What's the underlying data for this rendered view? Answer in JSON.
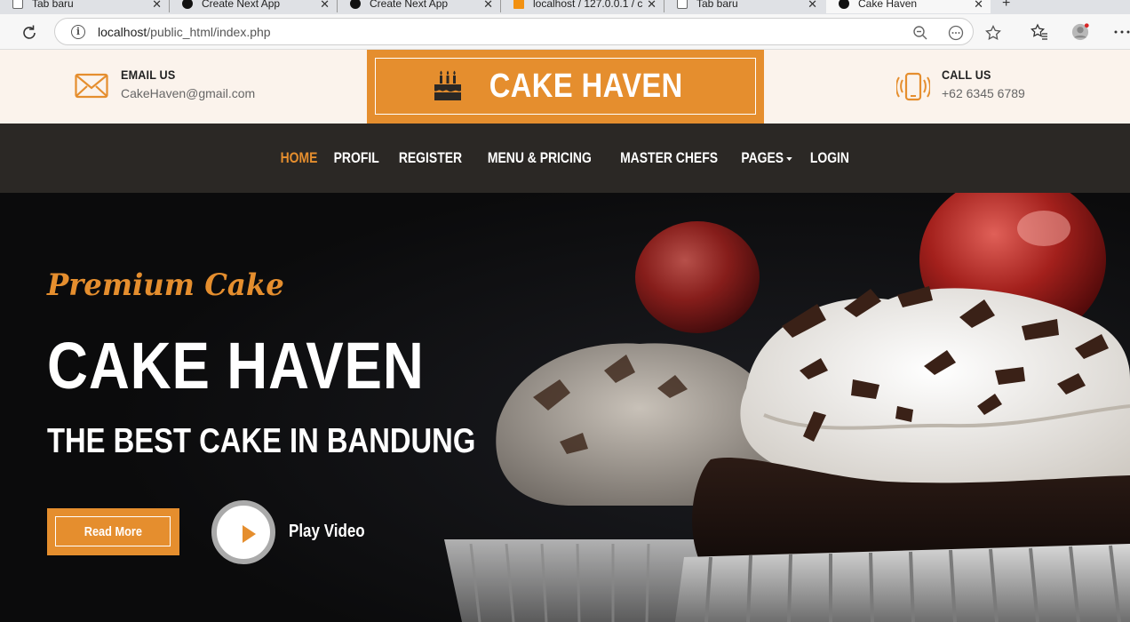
{
  "browser": {
    "tabs": [
      {
        "title": "Tab baru",
        "icon": "new-tab-page-icon",
        "active": false
      },
      {
        "title": "Create Next App",
        "icon": "nextjs-icon",
        "active": false
      },
      {
        "title": "Create Next App",
        "icon": "nextjs-icon",
        "active": false
      },
      {
        "title": "localhost / 127.0.0.1 / c",
        "icon": "phpmyadmin-icon",
        "active": false
      },
      {
        "title": "Tab baru",
        "icon": "new-tab-page-icon",
        "active": false
      },
      {
        "title": "Cake Haven",
        "icon": "site-icon",
        "active": true
      }
    ],
    "url_host": "localhost",
    "url_path": "/public_html/index.php"
  },
  "header": {
    "email_label": "EMAIL US",
    "email_value": "CakeHaven@gmail.com",
    "brand": "CAKE HAVEN",
    "call_label": "CALL US",
    "call_value": "+62 6345 6789"
  },
  "nav": {
    "items": [
      "HOME",
      "PROFIL",
      "REGISTER",
      "MENU & PRICING",
      "MASTER CHEFS",
      "PAGES",
      "LOGIN"
    ],
    "active_index": 0
  },
  "hero": {
    "subtitle": "Premium Cake",
    "title": "CAKE HAVEN",
    "tagline": "THE BEST CAKE IN BANDUNG",
    "read_more": "Read More",
    "play_video": "Play Video"
  },
  "colors": {
    "accent": "#e58e2e",
    "topbar_bg": "#fbf3ec",
    "nav_bg": "#2b2825",
    "hero_bg": "#0c0c0d"
  }
}
